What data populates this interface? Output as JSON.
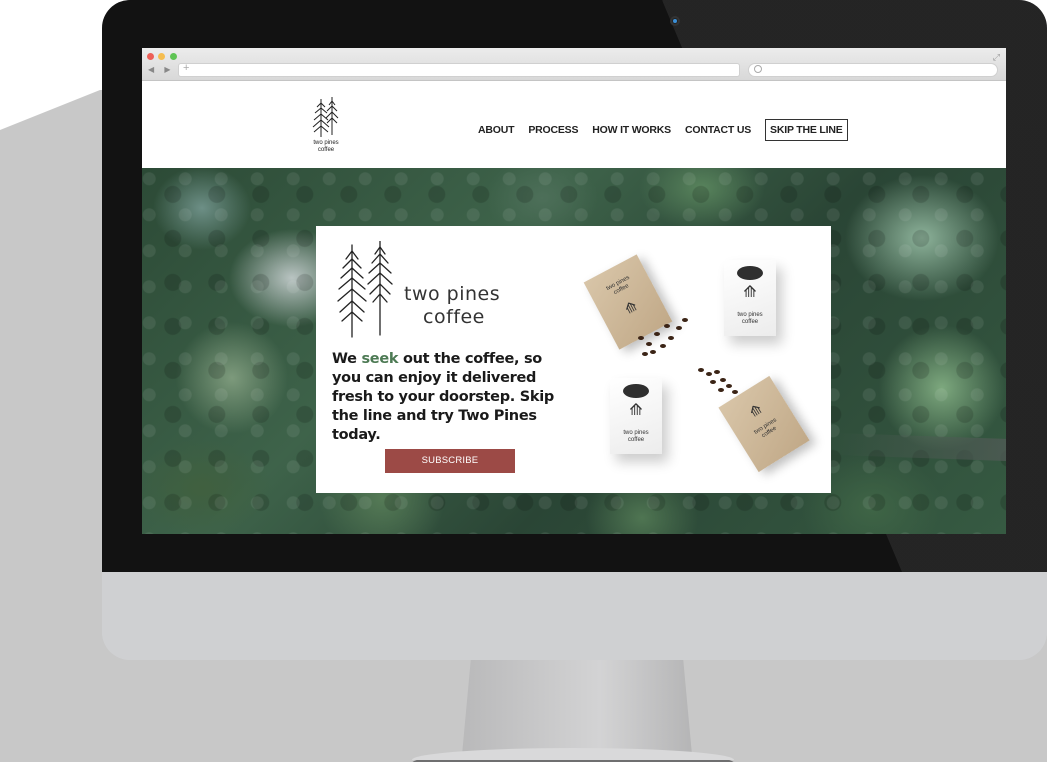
{
  "browser": {
    "window_controls": [
      "close",
      "minimize",
      "maximize"
    ],
    "address_placeholder": "+"
  },
  "header": {
    "logo_line1": "two pines",
    "logo_line2": "coffee"
  },
  "nav": {
    "items": [
      {
        "label": "ABOUT"
      },
      {
        "label": "PROCESS"
      },
      {
        "label": "HOW IT WORKS"
      },
      {
        "label": "CONTACT US"
      }
    ],
    "cta": "SKIP THE LINE"
  },
  "hero": {
    "card_logo_line1": "two pines",
    "card_logo_line2": "coffee",
    "tagline_start": "We ",
    "tagline_accent": "seek",
    "tagline_end": " out the coffee, so you can enjoy it delivered fresh to your doorstep. Skip the line and try Two Pines today.",
    "subscribe_label": "SUBSCRIBE",
    "bag_label_line1": "two pines",
    "bag_label_line2": "coffee"
  },
  "colors": {
    "accent_green": "#4d7a54",
    "button_red": "#9c4a46"
  }
}
